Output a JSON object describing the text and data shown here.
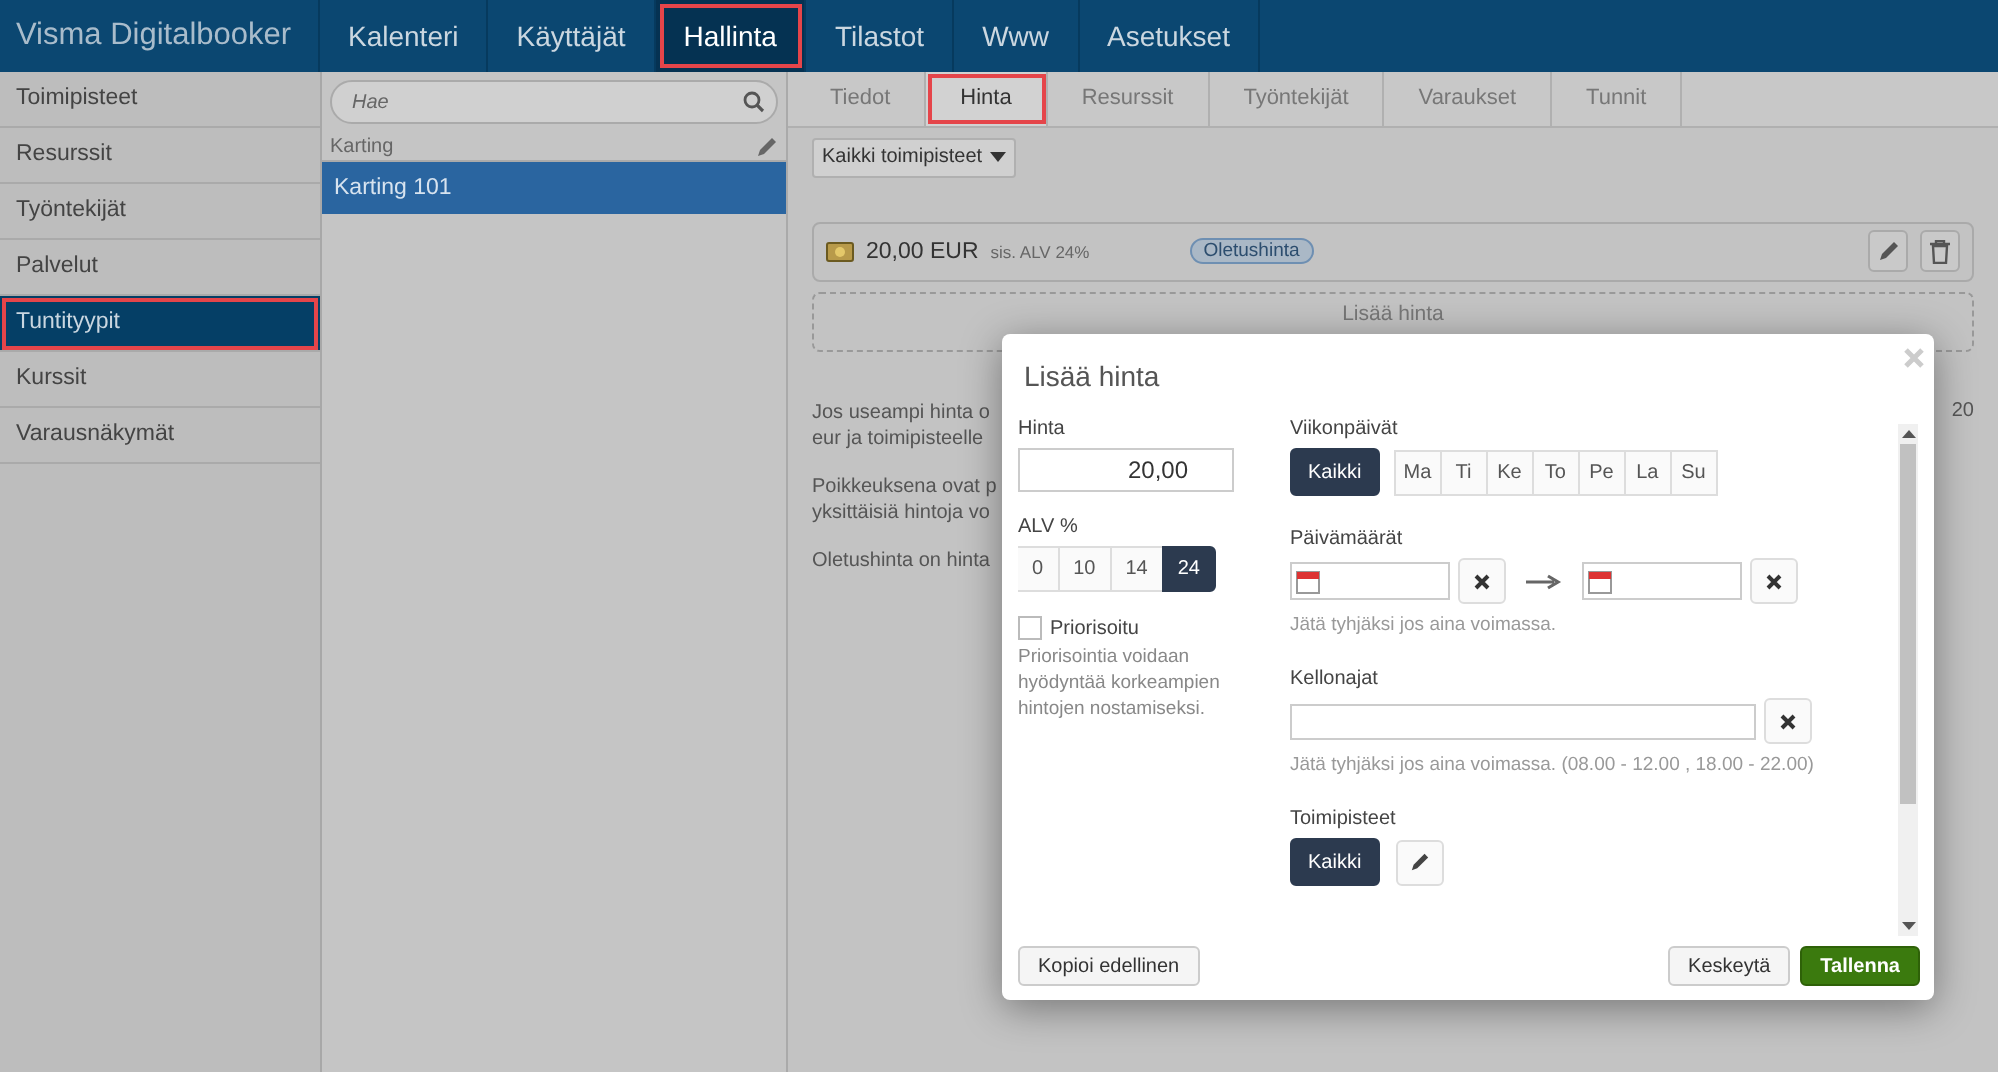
{
  "header": {
    "brand": "Visma Digitalbooker",
    "nav": [
      {
        "label": "Kalenteri",
        "selected": false
      },
      {
        "label": "Käyttäjät",
        "selected": false
      },
      {
        "label": "Hallinta",
        "selected": true
      },
      {
        "label": "Tilastot",
        "selected": false
      },
      {
        "label": "Www",
        "selected": false
      },
      {
        "label": "Asetukset",
        "selected": false
      }
    ]
  },
  "sidebar": {
    "items": [
      {
        "label": "Toimipisteet",
        "selected": false
      },
      {
        "label": "Resurssit",
        "selected": false
      },
      {
        "label": "Työntekijät",
        "selected": false
      },
      {
        "label": "Palvelut",
        "selected": false
      },
      {
        "label": "Tuntityypit",
        "selected": true
      },
      {
        "label": "Kurssit",
        "selected": false
      },
      {
        "label": "Varausnäkymät",
        "selected": false
      }
    ]
  },
  "list": {
    "search_placeholder": "Hae",
    "group": "Karting",
    "items": [
      {
        "label": "Karting 101",
        "selected": true
      }
    ]
  },
  "tabs": [
    {
      "label": "Tiedot",
      "selected": false
    },
    {
      "label": "Hinta",
      "selected": true
    },
    {
      "label": "Resurssit",
      "selected": false
    },
    {
      "label": "Työntekijät",
      "selected": false
    },
    {
      "label": "Varaukset",
      "selected": false
    },
    {
      "label": "Tunnit",
      "selected": false
    }
  ],
  "filter": {
    "label": "Kaikki toimipisteet"
  },
  "price_row": {
    "amount": "20,00 EUR",
    "vat": "sis. ALV 24%",
    "tag": "Oletushinta"
  },
  "add_price": "Lisää hinta",
  "info": {
    "paragraphs": [
      [
        "Jos useampi hinta o",
        "eur ja toimipisteelle"
      ],
      [
        "Poikkeuksena ovat p",
        "yksittäisiä hintoja vo"
      ],
      [
        "Oletushinta on hinta"
      ]
    ],
    "tail": "20"
  },
  "dialog": {
    "title": "Lisää hinta",
    "price": {
      "label": "Hinta",
      "value": "20,00"
    },
    "vat": {
      "label": "ALV %",
      "options": [
        {
          "label": "0",
          "selected": false
        },
        {
          "label": "10",
          "selected": false
        },
        {
          "label": "14",
          "selected": false
        },
        {
          "label": "24",
          "selected": true
        }
      ]
    },
    "priority": {
      "label": "Priorisoitu",
      "checked": false,
      "help": "Priorisointia voidaan hyödyntää korkeampien hintojen nostamiseksi."
    },
    "weekdays": {
      "label": "Viikonpäivät",
      "all": {
        "label": "Kaikki",
        "selected": true
      },
      "options": [
        {
          "label": "Ma",
          "selected": false
        },
        {
          "label": "Ti",
          "selected": false
        },
        {
          "label": "Ke",
          "selected": false
        },
        {
          "label": "To",
          "selected": false
        },
        {
          "label": "Pe",
          "selected": false
        },
        {
          "label": "La",
          "selected": false
        },
        {
          "label": "Su",
          "selected": false
        }
      ]
    },
    "dates": {
      "label": "Päivämäärät",
      "hint": "Jätä tyhjäksi jos aina voimassa."
    },
    "times": {
      "label": "Kellonajat",
      "hint": "Jätä tyhjäksi jos aina voimassa. (08.00 - 12.00 , 18.00 - 22.00)"
    },
    "locations": {
      "label": "Toimipisteet",
      "all": {
        "label": "Kaikki",
        "selected": true
      }
    },
    "buttons": {
      "copy": "Kopioi edellinen",
      "cancel": "Keskeytä",
      "save": "Tallenna"
    }
  }
}
